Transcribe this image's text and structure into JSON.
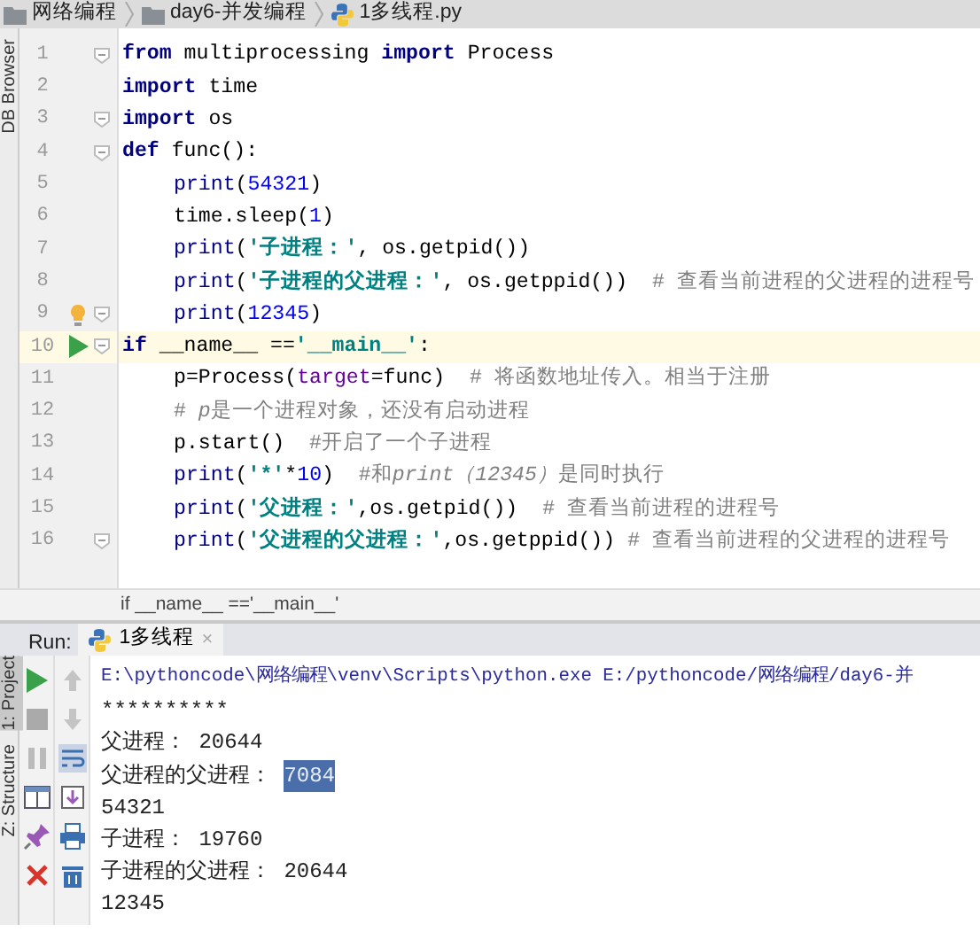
{
  "breadcrumbs": [
    {
      "kind": "folder",
      "label": "网络编程"
    },
    {
      "kind": "folder",
      "label": "day6-并发编程"
    },
    {
      "kind": "python",
      "label": "1多线程.py"
    }
  ],
  "left_tool_tabs": [
    "DB Browser"
  ],
  "editor": {
    "lines": [
      {
        "number": "1",
        "fold": true,
        "current": false,
        "indented": false,
        "tokens": [
          {
            "kind": "kw",
            "text": "from"
          },
          {
            "kind": "plain",
            "text": " multiprocessing "
          },
          {
            "kind": "kw",
            "text": "import"
          },
          {
            "kind": "plain",
            "text": " Process"
          }
        ]
      },
      {
        "number": "2",
        "fold": false,
        "current": false,
        "indented": false,
        "tokens": [
          {
            "kind": "kw",
            "text": "import"
          },
          {
            "kind": "plain",
            "text": " time"
          }
        ]
      },
      {
        "number": "3",
        "fold": true,
        "current": false,
        "indented": false,
        "tokens": [
          {
            "kind": "kw",
            "text": "import"
          },
          {
            "kind": "plain",
            "text": " os"
          }
        ]
      },
      {
        "number": "4",
        "fold": true,
        "current": false,
        "indented": false,
        "tokens": [
          {
            "kind": "kw",
            "text": "def"
          },
          {
            "kind": "plain",
            "text": " func():"
          }
        ]
      },
      {
        "number": "5",
        "fold": false,
        "current": false,
        "indented": true,
        "tokens": [
          {
            "kind": "builtin",
            "text": "print"
          },
          {
            "kind": "plain",
            "text": "("
          },
          {
            "kind": "num",
            "text": "54321"
          },
          {
            "kind": "plain",
            "text": ")"
          }
        ]
      },
      {
        "number": "6",
        "fold": false,
        "current": false,
        "indented": true,
        "tokens": [
          {
            "kind": "plain",
            "text": "time.sleep("
          },
          {
            "kind": "num",
            "text": "1"
          },
          {
            "kind": "plain",
            "text": ")"
          }
        ]
      },
      {
        "number": "7",
        "fold": false,
        "current": false,
        "indented": true,
        "tokens": [
          {
            "kind": "builtin",
            "text": "print"
          },
          {
            "kind": "plain",
            "text": "("
          },
          {
            "kind": "str",
            "text": "'子进程：'"
          },
          {
            "kind": "plain",
            "text": ", os.getpid())"
          }
        ]
      },
      {
        "number": "8",
        "fold": false,
        "current": false,
        "indented": true,
        "tokens": [
          {
            "kind": "builtin",
            "text": "print"
          },
          {
            "kind": "plain",
            "text": "("
          },
          {
            "kind": "str",
            "text": "'子进程的父进程：'"
          },
          {
            "kind": "plain",
            "text": ", os.getppid())  "
          },
          {
            "kind": "cmt",
            "text": "# 查看当前进程的父进程的进程号"
          }
        ]
      },
      {
        "number": "9",
        "fold": true,
        "current": false,
        "indented": true,
        "gutter": {
          "kind": "bulb"
        },
        "tokens": [
          {
            "kind": "builtin",
            "text": "print"
          },
          {
            "kind": "plain",
            "text": "("
          },
          {
            "kind": "num",
            "text": "12345"
          },
          {
            "kind": "plain",
            "text": ")"
          }
        ]
      },
      {
        "number": "10",
        "fold": true,
        "current": true,
        "indented": false,
        "gutter": {
          "kind": "run"
        },
        "tokens": [
          {
            "kind": "kw",
            "text": "if"
          },
          {
            "kind": "plain",
            "text": " __name__ =="
          },
          {
            "kind": "str",
            "text": "'__main__'"
          },
          {
            "kind": "plain",
            "text": ":"
          }
        ]
      },
      {
        "number": "11",
        "fold": false,
        "current": false,
        "indented": true,
        "tokens": [
          {
            "kind": "plain",
            "text": "p=Process("
          },
          {
            "kind": "param",
            "text": "target"
          },
          {
            "kind": "plain",
            "text": "=func)  "
          },
          {
            "kind": "cmt",
            "text": "# 将函数地址传入。相当于注册"
          }
        ]
      },
      {
        "number": "12",
        "fold": false,
        "current": false,
        "indented": true,
        "tokens": [
          {
            "kind": "cmt",
            "text": "# "
          },
          {
            "kind": "cmti",
            "text": "p"
          },
          {
            "kind": "cmt",
            "text": "是一个进程对象，还没有启动进程"
          }
        ]
      },
      {
        "number": "13",
        "fold": false,
        "current": false,
        "indented": true,
        "tokens": [
          {
            "kind": "plain",
            "text": "p.start()  "
          },
          {
            "kind": "cmt",
            "text": "#开启了一个子进程"
          }
        ]
      },
      {
        "number": "14",
        "fold": false,
        "current": false,
        "indented": true,
        "tokens": [
          {
            "kind": "builtin",
            "text": "print"
          },
          {
            "kind": "plain",
            "text": "("
          },
          {
            "kind": "str",
            "text": "'*'"
          },
          {
            "kind": "plain",
            "text": "*"
          },
          {
            "kind": "num",
            "text": "10"
          },
          {
            "kind": "plain",
            "text": ")  "
          },
          {
            "kind": "cmt",
            "text": "#和"
          },
          {
            "kind": "cmti",
            "text": "print（12345）"
          },
          {
            "kind": "cmt",
            "text": "是同时执行"
          }
        ]
      },
      {
        "number": "15",
        "fold": false,
        "current": false,
        "indented": true,
        "tokens": [
          {
            "kind": "builtin",
            "text": "print"
          },
          {
            "kind": "plain",
            "text": "("
          },
          {
            "kind": "str",
            "text": "'父进程：'"
          },
          {
            "kind": "plain",
            "text": ",os.getpid())  "
          },
          {
            "kind": "cmt",
            "text": "# 查看当前进程的进程号"
          }
        ]
      },
      {
        "number": "16",
        "fold": true,
        "current": false,
        "indented": true,
        "tokens": [
          {
            "kind": "builtin",
            "text": "print"
          },
          {
            "kind": "plain",
            "text": "("
          },
          {
            "kind": "str",
            "text": "'父进程的父进程：'"
          },
          {
            "kind": "plain",
            "text": ",os.getppid()) "
          },
          {
            "kind": "cmt",
            "text": "# 查看当前进程的父进程的进程号"
          }
        ]
      }
    ],
    "breadcrumb": "if __name__ =='__main__'"
  },
  "run_panel": {
    "label": "Run:",
    "tab": {
      "title": "1多线程",
      "close": "×"
    },
    "side_tabs": [
      "1: Project",
      "Z: Structure"
    ],
    "console": [
      [
        {
          "kind": "path",
          "text": "E:\\pythoncode\\网络编程\\venv\\Scripts\\python.exe E:/pythoncode/网络编程/day6-并"
        }
      ],
      [
        {
          "kind": "out",
          "text": "**********"
        }
      ],
      [
        {
          "kind": "out",
          "text": "父进程： 20644"
        }
      ],
      [
        {
          "kind": "out",
          "text": "父进程的父进程： "
        },
        {
          "kind": "out",
          "text": "7084",
          "selected": true
        }
      ],
      [
        {
          "kind": "out",
          "text": "54321"
        }
      ],
      [
        {
          "kind": "out",
          "text": "子进程： 19760"
        }
      ],
      [
        {
          "kind": "out",
          "text": "子进程的父进程： 20644"
        }
      ],
      [
        {
          "kind": "out",
          "text": "12345"
        }
      ]
    ]
  }
}
